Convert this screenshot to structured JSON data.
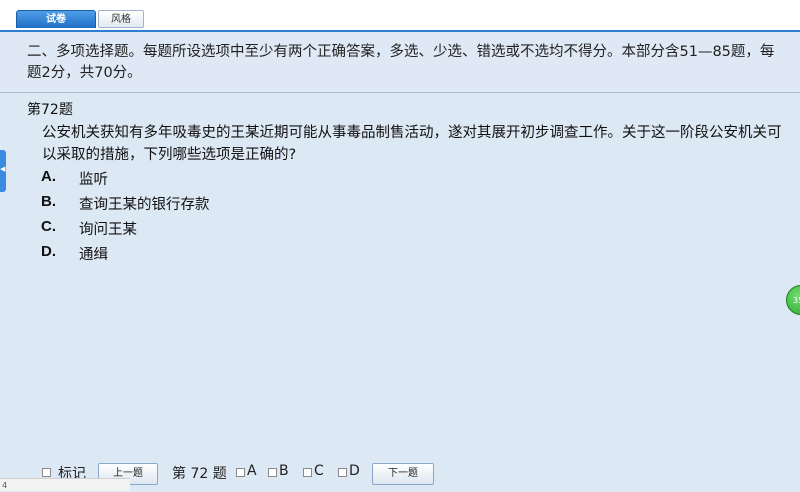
{
  "tabs": [
    {
      "label": "试卷",
      "active": true
    },
    {
      "label": "风格",
      "active": false
    }
  ],
  "instructions": "二、多项选择题。每题所设选项中至少有两个正确答案，多选、少选、错选或不选均不得分。本部分含51—85题，每题2分，共70分。",
  "question": {
    "number_label": "第72题",
    "stem": "公安机关获知有多年吸毒史的王某近期可能从事毒品制售活动，遂对其展开初步调查工作。关于这一阶段公安机关可以采取的措施，下列哪些选项是正确的?",
    "options": [
      {
        "letter": "A.",
        "text": "监听"
      },
      {
        "letter": "B.",
        "text": "查询王某的银行存款"
      },
      {
        "letter": "C.",
        "text": "询问王某"
      },
      {
        "letter": "D.",
        "text": "通缉"
      }
    ]
  },
  "timer_bubble": "35",
  "bottom": {
    "mark_label": "标记",
    "prev_label": "上一题",
    "question_label": "第 72 题",
    "answer_choices": [
      "A",
      "B",
      "C",
      "D"
    ],
    "next_label": "下一题"
  },
  "status_text": "4",
  "colors": {
    "accent": "#2c7fd0",
    "background": "#dde8f5",
    "bubble": "#2ea82e"
  }
}
